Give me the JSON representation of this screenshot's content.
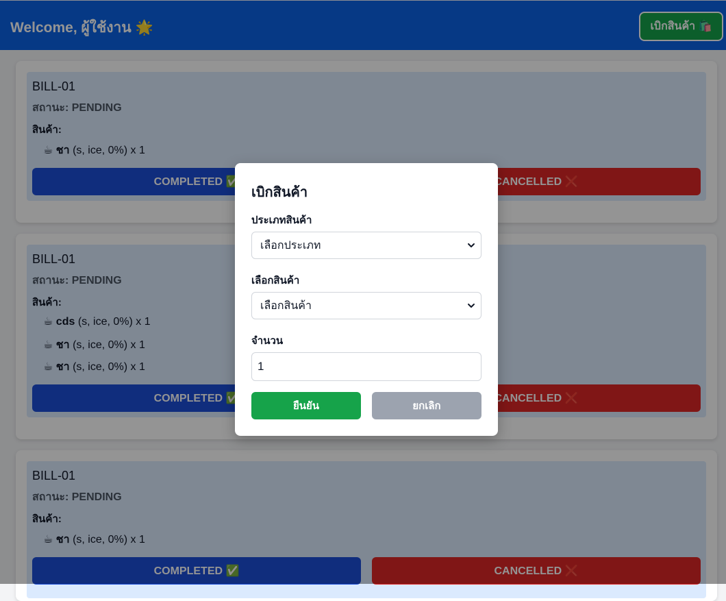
{
  "header": {
    "welcome": "Welcome, ผู้ใช้งาน 🌟",
    "withdraw_button": "เบิกสินค้า 🛍️"
  },
  "bills": [
    {
      "title": "BILL-01",
      "status": "สถานะ: PENDING",
      "items_label": "สินค้า:",
      "items": [
        {
          "icon": "☕",
          "name": "ชา",
          "detail": " (s, ice, 0%) x 1"
        }
      ],
      "complete_label": "COMPLETED ✅",
      "cancel_label": "CANCELLED ❌"
    },
    {
      "title": "BILL-01",
      "status": "สถานะ: PENDING",
      "items_label": "สินค้า:",
      "items": [
        {
          "icon": "☕",
          "name": "cds",
          "detail": " (s, ice, 0%) x 1"
        },
        {
          "icon": "☕",
          "name": "ชา",
          "detail": " (s, ice, 0%) x 1"
        },
        {
          "icon": "☕",
          "name": "ชา",
          "detail": " (s, ice, 0%) x 1"
        }
      ],
      "complete_label": "COMPLETED ✅",
      "cancel_label": "CANCELLED ❌"
    },
    {
      "title": "BILL-01",
      "status": "สถานะ: PENDING",
      "items_label": "สินค้า:",
      "items": [
        {
          "icon": "☕",
          "name": "ชา",
          "detail": " (s, ice, 0%) x 1"
        }
      ],
      "complete_label": "COMPLETED ✅",
      "cancel_label": "CANCELLED ❌"
    }
  ],
  "modal": {
    "title": "เบิกสินค้า",
    "category_label": "ประเภทสินค้า",
    "category_selected": "เลือกประเภท",
    "product_label": "เลือกสินค้า",
    "product_selected": "เลือกสินค้า",
    "quantity_label": "จำนวน",
    "quantity_value": "1",
    "confirm_label": "ยืนยัน",
    "cancel_label": "ยกเลิก"
  },
  "colors": {
    "header": "#0b63e5",
    "confirm": "#16a34a",
    "complete": "#1d4ed8",
    "cancel": "#dc2626",
    "modal_cancel": "#9ca3af"
  }
}
